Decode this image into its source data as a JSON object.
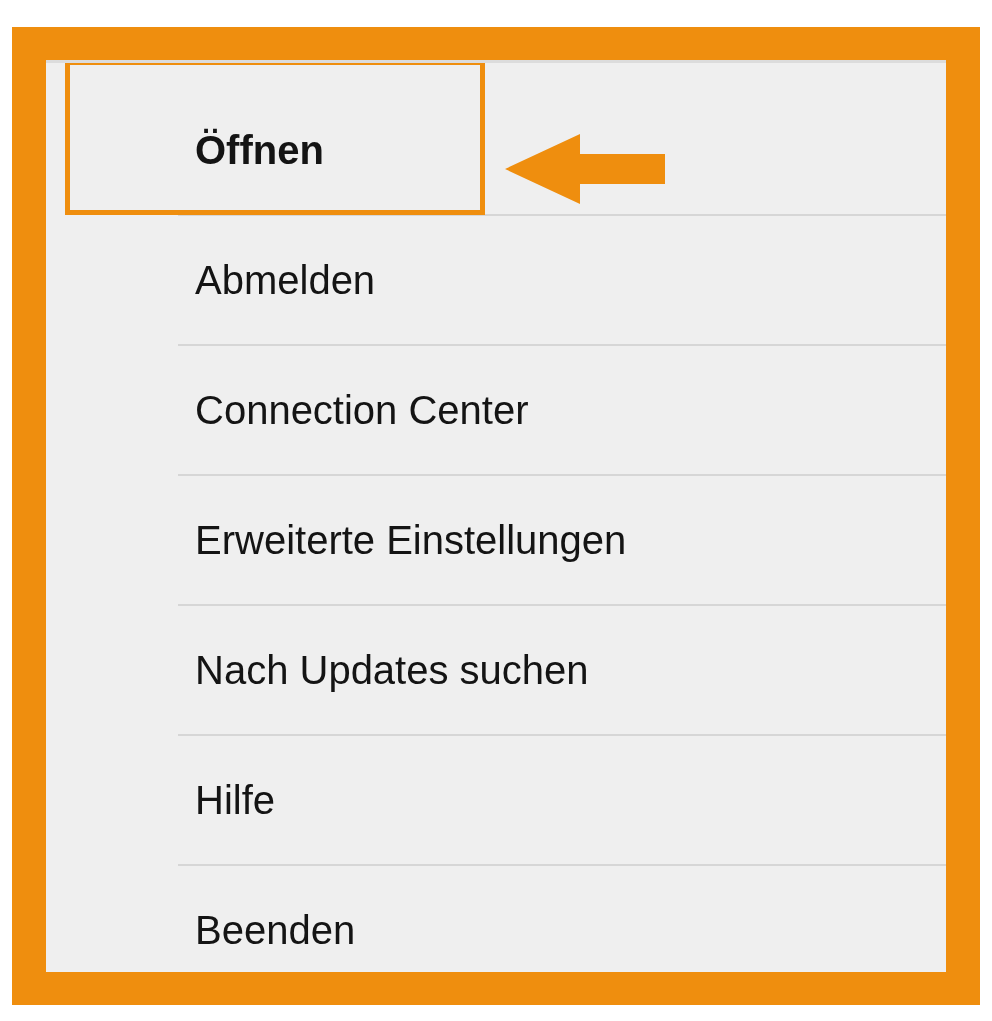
{
  "menu": {
    "items": [
      {
        "label": "Öffnen",
        "default": true,
        "highlighted": true
      },
      {
        "label": "Abmelden",
        "default": false,
        "highlighted": false
      },
      {
        "label": "Connection Center",
        "default": false,
        "highlighted": false
      },
      {
        "label": "Erweiterte Einstellungen",
        "default": false,
        "highlighted": false
      },
      {
        "label": "Nach Updates suchen",
        "default": false,
        "highlighted": false
      },
      {
        "label": "Hilfe",
        "default": false,
        "highlighted": false
      },
      {
        "label": "Beenden",
        "default": false,
        "highlighted": false
      }
    ]
  }
}
